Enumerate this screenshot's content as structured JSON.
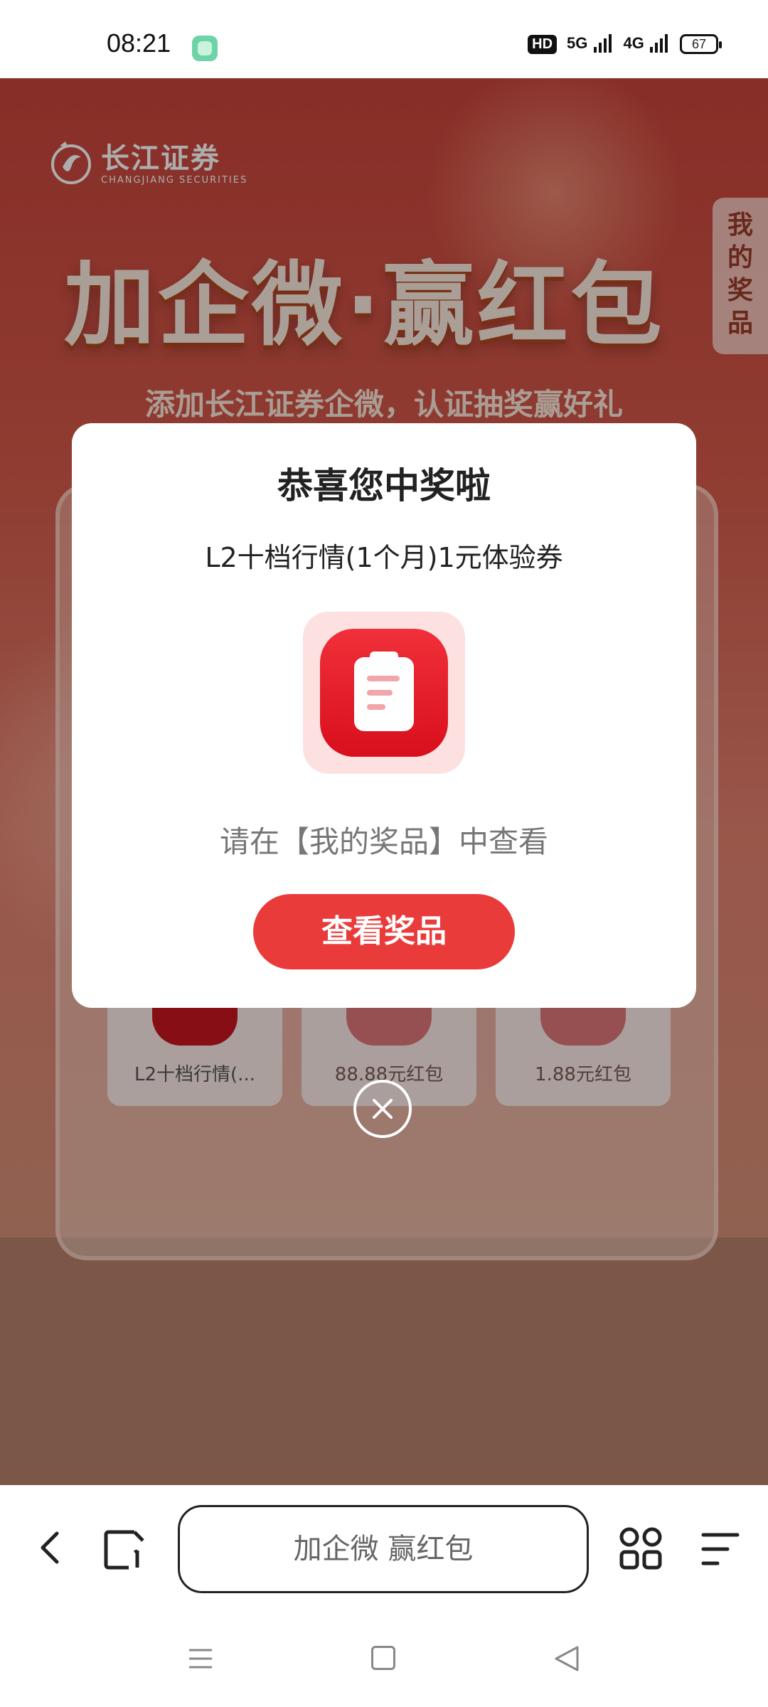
{
  "status_bar": {
    "time": "08:21",
    "hd_badge": "HD",
    "network_5g": "5G",
    "network_4g": "4G",
    "battery": "67"
  },
  "page": {
    "brand_name_cn": "长江证券",
    "brand_name_en": "CHANGJIANG SECURITIES",
    "hero_title": "加企微·赢红包",
    "hero_subtitle": "添加长江证券企微，认证抽奖赢好礼",
    "my_prizes_tab": [
      "我",
      "的",
      "奖",
      "品"
    ],
    "prize_cards": [
      {
        "name": "L2十档行情(..."
      },
      {
        "name": "88.88元红包"
      },
      {
        "name": "1.88元红包"
      }
    ]
  },
  "modal": {
    "title": "恭喜您中奖啦",
    "prize_name": "L2十档行情(1个月)1元体验券",
    "hint": "请在【我的奖品】中查看",
    "button_label": "查看奖品",
    "icon": "document-icon"
  },
  "toolbar": {
    "address_text": "加企微 赢红包"
  },
  "colors": {
    "accent": "#ea3b3b",
    "icon_red": "#d80f1c"
  }
}
